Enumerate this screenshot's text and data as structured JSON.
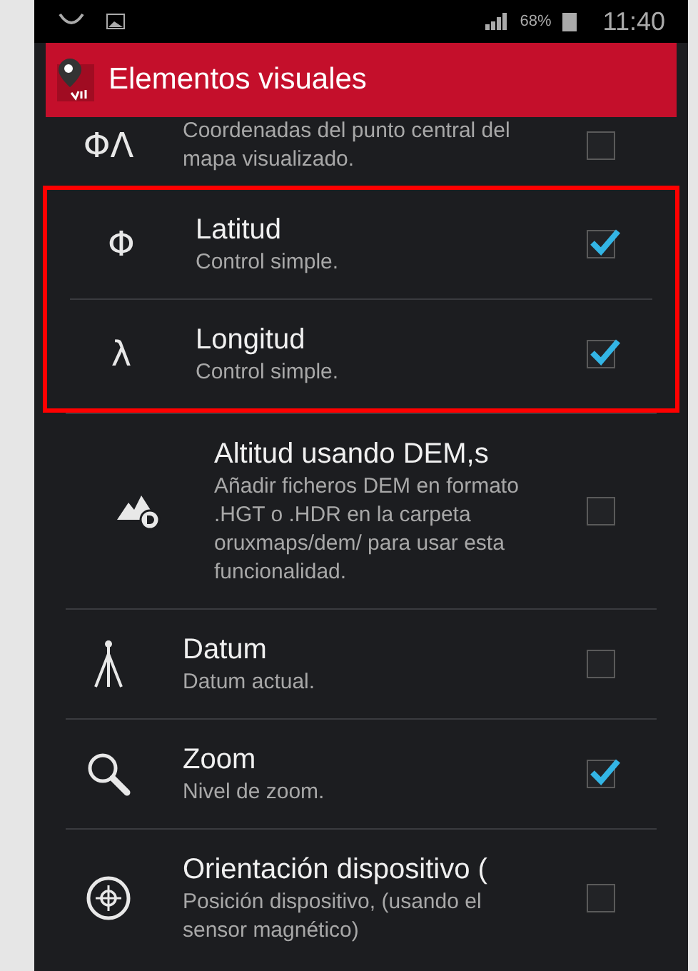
{
  "status_bar": {
    "battery": "68%",
    "time": "11:40"
  },
  "header": {
    "title": "Elementos visuales"
  },
  "items": [
    {
      "icon": {
        "kind": "glyph",
        "text": "ΦΛ"
      },
      "description": "Coordenadas del punto central del mapa visualizado.",
      "checked": false,
      "highlighted": false
    },
    {
      "icon": {
        "kind": "glyph",
        "text": "Φ"
      },
      "title": "Latitud",
      "description": "Control simple.",
      "checked": true,
      "highlighted": true
    },
    {
      "icon": {
        "kind": "glyph",
        "text": "λ"
      },
      "title": "Longitud",
      "description": "Control simple.",
      "checked": true,
      "highlighted": true
    },
    {
      "icon": {
        "kind": "mountain"
      },
      "title": "Altitud usando DEM,s",
      "description": "Añadir ficheros DEM en formato .HGT o .HDR en la carpeta oruxmaps/dem/ para usar esta funcionalidad.",
      "checked": false,
      "highlighted": false
    },
    {
      "icon": {
        "kind": "tripod"
      },
      "title": "Datum",
      "description": "Datum actual.",
      "checked": false,
      "highlighted": false
    },
    {
      "icon": {
        "kind": "magnifier"
      },
      "title": "Zoom",
      "description": "Nivel de zoom.",
      "checked": true,
      "highlighted": false
    },
    {
      "icon": {
        "kind": "compass"
      },
      "title": "Orientación dispositivo (",
      "description": "Posición dispositivo, (usando el sensor magnético)",
      "checked": false,
      "highlighted": false
    }
  ]
}
